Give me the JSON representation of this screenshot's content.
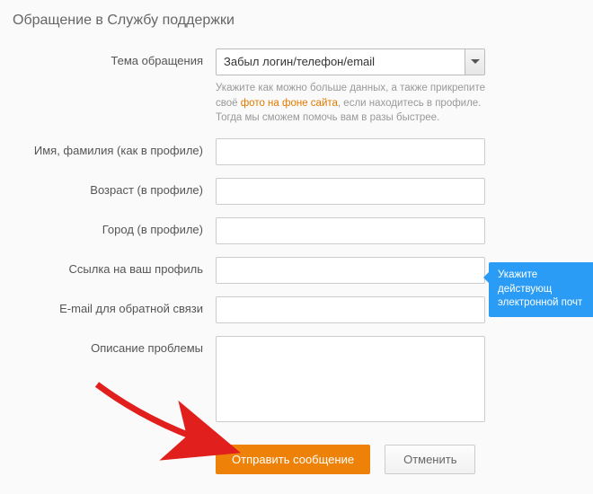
{
  "title": "Обращение в Службу поддержки",
  "labels": {
    "topic": "Тема обращения",
    "name": "Имя, фамилия (как в профиле)",
    "age": "Возраст (в профиле)",
    "city": "Город (в профиле)",
    "profile_link": "Ссылка на ваш профиль",
    "email": "E-mail для обратной связи",
    "description": "Описание проблемы"
  },
  "topic_selected": "Забыл логин/телефон/email",
  "hint": {
    "part1": "Укажите как можно больше данных, а также прикрепите своё ",
    "link": "фото на фоне сайта",
    "part2": ", если находитесь в профиле. Тогда мы сможем помочь вам в разы быстрее."
  },
  "tooltip": {
    "line1": "Укажите действующ",
    "line2": "электронной почт"
  },
  "buttons": {
    "submit": "Отправить сообщение",
    "cancel": "Отменить"
  }
}
